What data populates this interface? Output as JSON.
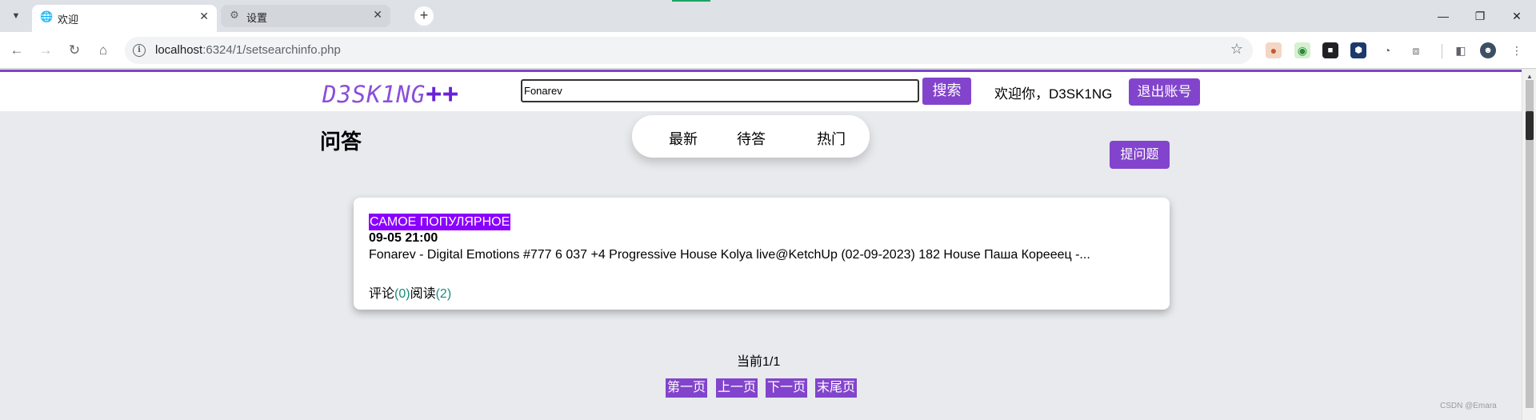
{
  "browser": {
    "tabs": [
      {
        "label": "欢迎",
        "icon": "globe-icon",
        "active": true
      },
      {
        "label": "设置",
        "icon": "gear-icon",
        "active": false
      }
    ],
    "url_host": "localhost",
    "url_path": ":6324/1/setsearchinfo.php"
  },
  "site": {
    "logo_text": "D3SK1NG",
    "logo_suffix": "++",
    "search_value": "Fonarev",
    "search_button": "搜索",
    "welcome": "欢迎你，D3SK1NG",
    "logout_button": "退出账号"
  },
  "main": {
    "title": "问答",
    "tabs": [
      "最新",
      "待答",
      "热门"
    ],
    "ask_button": "提问题"
  },
  "post": {
    "title": "САМОЕ ПОПУЛЯРНОЕ",
    "date": "09-05 21:00",
    "body": "Fonarev - Digital Emotions #777 6 037 +4 Progressive House Kolya live@KetchUp (02-09-2023) 182 House Паша Корееец -...",
    "comments_label": "评论",
    "comments_count": "(0)",
    "reads_label": "阅读",
    "reads_count": "(2)"
  },
  "pagination": {
    "info": "当前1/1",
    "first": "第一页",
    "prev": "上一页",
    "next": "下一页",
    "last": "末尾页"
  },
  "watermark": "CSDN @Emara",
  "colors": {
    "accent": "#8244cc",
    "highlight": "#8a00ff",
    "count": "#1a8a7a"
  }
}
